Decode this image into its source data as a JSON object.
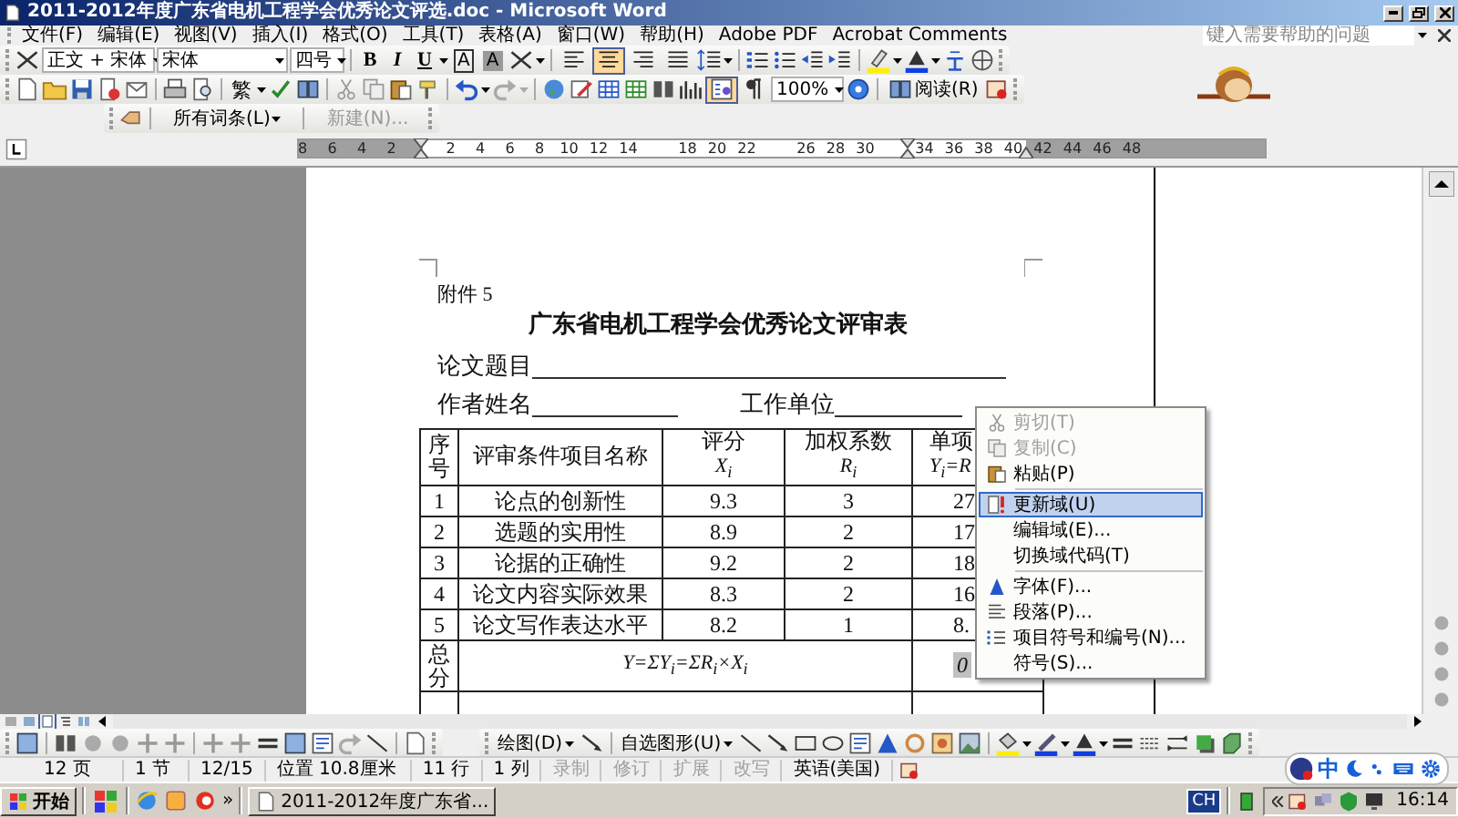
{
  "window": {
    "title": "2011-2012年度广东省电机工程学会优秀论文评选.doc - Microsoft Word"
  },
  "menu": [
    "文件(F)",
    "编辑(E)",
    "视图(V)",
    "插入(I)",
    "格式(O)",
    "工具(T)",
    "表格(A)",
    "窗口(W)",
    "帮助(H)",
    "Adobe PDF",
    "Acrobat Comments"
  ],
  "help_box": {
    "placeholder": "键入需要帮助的问题"
  },
  "formatting_toolbar": {
    "style": "正文 + 宋体",
    "font": "宋体",
    "size": "四号",
    "text_buttons": [
      "B",
      "I",
      "U"
    ],
    "char_buttons": [
      "A",
      "A"
    ],
    "align": [
      {
        "selected": false
      },
      {
        "selected": true
      },
      {
        "selected": false
      },
      {
        "selected": false
      }
    ]
  },
  "standard_toolbar": {
    "convert_button": "繁",
    "zoom": "100%",
    "read_button": "阅读(R)"
  },
  "autotext_toolbar": {
    "items": [
      {
        "label": "所有词条(L)",
        "kind": "menu",
        "disabled": false
      },
      {
        "label": "新建(N)...",
        "kind": "button",
        "disabled": true
      }
    ]
  },
  "ruler": {
    "labels": [
      "8",
      "6",
      "4",
      "2",
      "2",
      "4",
      "6",
      "8",
      "10",
      "12",
      "14",
      "18",
      "20",
      "22",
      "26",
      "28",
      "30",
      "34",
      "36",
      "38",
      "40",
      "42",
      "44",
      "46",
      "48"
    ]
  },
  "document": {
    "annex": "附件 5",
    "title": "广东省电机工程学会优秀论文评审表",
    "fields": [
      {
        "label": "论文题目"
      },
      {
        "label": "作者姓名"
      },
      {
        "label": "工作单位"
      }
    ],
    "table": {
      "columns": [
        {
          "text": "序号"
        },
        {
          "text": "评审条件项目名称"
        },
        {
          "text": "评分",
          "formula": "X$_{i}$"
        },
        {
          "text": "加权系数",
          "formula": "R$_{i}$"
        },
        {
          "text": "单项",
          "formula": "Y$_{i}$=R"
        }
      ],
      "rows": [
        [
          "1",
          "论点的创新性",
          "9.3",
          "3",
          "27"
        ],
        [
          "2",
          "选题的实用性",
          "8.9",
          "2",
          "17"
        ],
        [
          "3",
          "论据的正确性",
          "9.2",
          "2",
          "18"
        ],
        [
          "4",
          "论文内容实际效果",
          "8.3",
          "2",
          "16"
        ],
        [
          "5",
          "论文写作表达水平",
          "8.2",
          "1",
          "8."
        ]
      ],
      "total": {
        "label": "总分",
        "formula": "Y=ΣY$_{i}$=ΣR$_{i}$×X$_{i}$",
        "value": "0"
      }
    }
  },
  "context_menu": {
    "items": [
      {
        "kind": "item",
        "label": "剪切(T)",
        "disabled": true,
        "selected": false
      },
      {
        "kind": "item",
        "label": "复制(C)",
        "disabled": true,
        "selected": false
      },
      {
        "kind": "item",
        "label": "粘贴(P)",
        "disabled": false,
        "selected": false
      },
      {
        "kind": "separator"
      },
      {
        "kind": "item",
        "label": "更新域(U)",
        "disabled": false,
        "selected": true
      },
      {
        "kind": "item",
        "label": "编辑域(E)...",
        "disabled": false,
        "selected": false
      },
      {
        "kind": "item",
        "label": "切换域代码(T)",
        "disabled": false,
        "selected": false
      },
      {
        "kind": "separator"
      },
      {
        "kind": "item",
        "label": "字体(F)...",
        "disabled": false,
        "selected": false
      },
      {
        "kind": "item",
        "label": "段落(P)...",
        "disabled": false,
        "selected": false
      },
      {
        "kind": "item",
        "label": "项目符号和编号(N)...",
        "disabled": false,
        "selected": false
      },
      {
        "kind": "item",
        "label": "符号(S)...",
        "disabled": false,
        "selected": false
      }
    ]
  },
  "drawing_toolbar": {
    "menus": [
      "绘图(D)",
      "自选图形(U)"
    ]
  },
  "status_bar": {
    "items": [
      {
        "text": "12 页",
        "disabled": false
      },
      {
        "text": "1 节",
        "disabled": false
      },
      {
        "text": "12/15",
        "disabled": false
      },
      {
        "text": "位置 10.8厘米",
        "disabled": false
      },
      {
        "text": "11 行",
        "disabled": false
      },
      {
        "text": "1 列",
        "disabled": false
      },
      {
        "text": "录制",
        "disabled": true
      },
      {
        "text": "修订",
        "disabled": true
      },
      {
        "text": "扩展",
        "disabled": true
      },
      {
        "text": "改写",
        "disabled": true
      },
      {
        "text": "英语(美国)",
        "disabled": false
      }
    ]
  },
  "ime_bar": {
    "label": "中"
  },
  "taskbar": {
    "start": "开始",
    "overflow": "»",
    "tasks": [
      {
        "label": "2011-2012年度广东省...",
        "selected": false
      }
    ],
    "language": "CH",
    "clock": "16:14"
  }
}
